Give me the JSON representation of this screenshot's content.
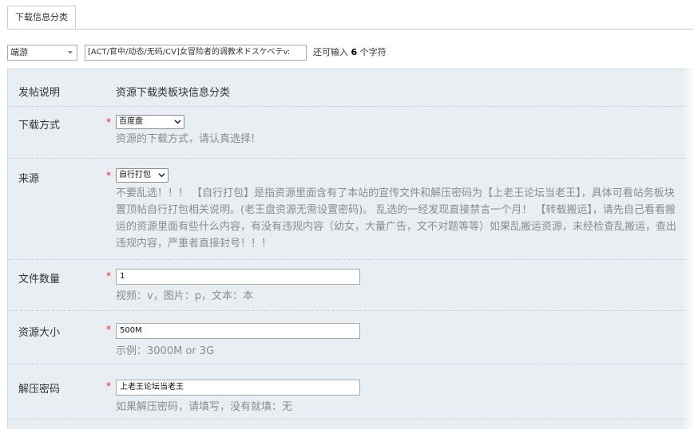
{
  "tab": {
    "label": "下载信息分类"
  },
  "topbar": {
    "category_value": "端游",
    "title_value": "[ACT/官中/动态/无码/CV]女冒险者的调教术ドスケベテv:",
    "remain_prefix": "还可输入 ",
    "remain_count": "6",
    "remain_suffix": " 个字符"
  },
  "form": {
    "intro": {
      "label": "发帖说明",
      "value": "资源下载类板块信息分类"
    },
    "download": {
      "label": "下载方式",
      "required": "*",
      "value": "百度盘",
      "help": "资源的下载方式，请认真选择!"
    },
    "source": {
      "label": "来源",
      "required": "*",
      "value": "自行打包",
      "help_lines": [
        "不要乱选！！！ 【自行打包】是指资源里面含有了本站的宣传文件和解压密码为【上老王论坛当老王】，具体可看站务板块",
        "置顶帖自行打包相关说明。(老王盘资源无需设置密码)。 乱选的一经发现直接禁言一个月！ 【转载搬运】，请先自己看看搬",
        "运的资源里面有些什么内容，有没有违规内容（幼女，大量广告，文不对题等等）如果乱搬运资源，未经检查乱搬运，查出",
        "违规内容，严重者直接封号！！！"
      ]
    },
    "filecount": {
      "label": "文件数量",
      "required": "*",
      "value": "1",
      "help": "视频：v，图片：p，文本：本"
    },
    "size": {
      "label": "资源大小",
      "required": "*",
      "value": "500M",
      "help": "示例：3000M or 3G"
    },
    "password": {
      "label": "解压密码",
      "required": "*",
      "value": "上老王论坛当老王",
      "help": "如果解压密码，请填写，没有就填：无"
    }
  }
}
